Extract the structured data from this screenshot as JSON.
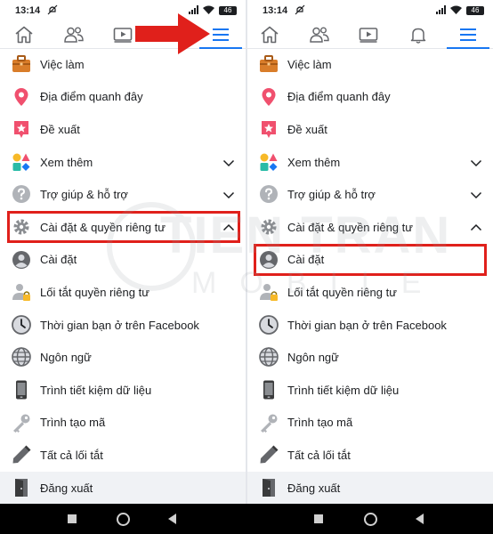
{
  "colors": {
    "accent": "#1877f2",
    "highlight": "#e0201b",
    "text": "#1c1e21",
    "icon_gray": "#65676b"
  },
  "status_bar": {
    "time": "13:14",
    "battery": "46"
  },
  "watermark": {
    "main": "TIEN TRAN",
    "sub": "MOBILE"
  },
  "tabs": [
    {
      "icon": "home-icon"
    },
    {
      "icon": "friends-icon"
    },
    {
      "icon": "watch-icon"
    },
    {
      "icon": "bell-icon"
    },
    {
      "icon": "menu-icon",
      "active": true
    }
  ],
  "menu": {
    "items": [
      {
        "label": "Việc làm",
        "icon": "briefcase-icon"
      },
      {
        "label": "Địa điểm quanh đây",
        "icon": "location-pin-icon"
      },
      {
        "label": "Đề xuất",
        "icon": "recommendation-star-icon"
      },
      {
        "label": "Xem thêm",
        "icon": "see-more-shapes-icon",
        "expandable": true
      },
      {
        "label": "Trợ giúp & hỗ trợ",
        "icon": "help-icon",
        "expandable": true
      },
      {
        "label": "Cài đặt & quyền riêng tư",
        "icon": "gear-icon",
        "expanded": true
      },
      {
        "label": "Cài đặt",
        "icon": "user-circle-icon"
      },
      {
        "label": "Lối tắt quyền riêng tư",
        "icon": "privacy-lock-icon"
      },
      {
        "label": "Thời gian bạn ở trên Facebook",
        "icon": "clock-icon"
      },
      {
        "label": "Ngôn ngữ",
        "icon": "globe-icon"
      },
      {
        "label": "Trình tiết kiệm dữ liệu",
        "icon": "phone-icon"
      },
      {
        "label": "Trình tạo mã",
        "icon": "key-icon"
      },
      {
        "label": "Tất cả lối tắt",
        "icon": "pencil-icon"
      },
      {
        "label": "Đăng xuất",
        "icon": "door-icon"
      }
    ]
  }
}
